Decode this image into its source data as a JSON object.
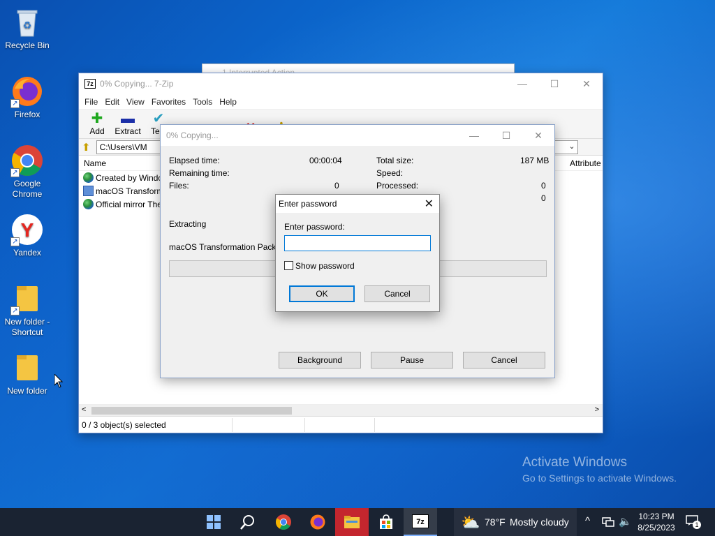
{
  "desktop": {
    "icons": [
      {
        "label": "Recycle Bin"
      },
      {
        "label": "Firefox"
      },
      {
        "label": "Google Chrome"
      },
      {
        "label": "Yandex"
      },
      {
        "label": "New folder - Shortcut"
      },
      {
        "label": "New folder"
      }
    ],
    "background_window_title": "1 Interrupted Action"
  },
  "zip_window": {
    "title": "0% Copying... 7-Zip",
    "menu": [
      "File",
      "Edit",
      "View",
      "Favorites",
      "Tools",
      "Help"
    ],
    "toolbar": [
      {
        "label": "Add",
        "icon": "plus-icon",
        "color": "#1fa81f"
      },
      {
        "label": "Extract",
        "icon": "minus-icon",
        "color": "#1b2fa8"
      },
      {
        "label": "Test",
        "icon": "check-icon",
        "color": "#2a9fc0"
      }
    ],
    "address": "C:\\Users\\VM",
    "columns": {
      "name": "Name",
      "attributes": "Attribute"
    },
    "files": [
      {
        "name": "Created by Windo",
        "icon": "globe-icon"
      },
      {
        "name": "macOS Transform",
        "icon": "disk-image-icon"
      },
      {
        "name": "Official mirror The",
        "icon": "globe-icon"
      }
    ],
    "status": "0 / 3 object(s) selected"
  },
  "copy_dialog": {
    "title": "0% Copying...",
    "elapsed_label": "Elapsed time:",
    "elapsed_value": "00:00:04",
    "remaining_label": "Remaining time:",
    "files_label": "Files:",
    "files_value": "0",
    "total_label": "Total size:",
    "total_value": "187 MB",
    "speed_label": "Speed:",
    "processed_label": "Processed:",
    "processed_value": "0",
    "extra_value": "0",
    "operation": "Extracting",
    "current_file": "macOS Transformation Pack 5.0",
    "progress": 0,
    "buttons": {
      "background": "Background",
      "pause": "Pause",
      "cancel": "Cancel"
    }
  },
  "password_dialog": {
    "title": "Enter password",
    "label": "Enter password:",
    "value": "",
    "show_password": "Show password",
    "show_password_checked": false,
    "ok": "OK",
    "cancel": "Cancel"
  },
  "watermark": {
    "line1": "Activate Windows",
    "line2": "Go to Settings to activate Windows."
  },
  "taskbar": {
    "weather_temp": "78°F",
    "weather_desc": "Mostly cloudy",
    "time": "10:23 PM",
    "date": "8/25/2023",
    "notification_count": "1",
    "accent": "#0078d7"
  }
}
